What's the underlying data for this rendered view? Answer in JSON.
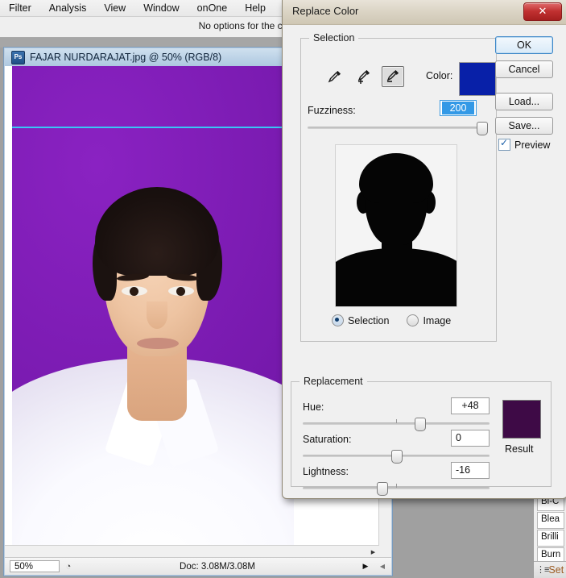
{
  "menubar": {
    "items": [
      "Filter",
      "Analysis",
      "View",
      "Window",
      "onOne",
      "Help"
    ]
  },
  "options_bar": {
    "text": "No options for the current tool."
  },
  "document_window": {
    "title": "FAJAR NURDARAJAT.jpg @ 50% (RGB/8)",
    "app_icon": "photoshop-icon",
    "status": {
      "zoom": "50%",
      "doc": "Doc: 3.08M/3.08M"
    }
  },
  "dialog": {
    "title": "Replace Color",
    "close_label": "✕",
    "selection": {
      "legend": "Selection",
      "eyedroppers": [
        {
          "name": "eyedropper-icon",
          "mode": "base",
          "selected": false
        },
        {
          "name": "eyedropper-add-icon",
          "mode": "add",
          "selected": false
        },
        {
          "name": "eyedropper-subtract-icon",
          "mode": "subtract",
          "selected": true
        }
      ],
      "color_label": "Color:",
      "color_value": "#0820A8",
      "fuzziness_label": "Fuzziness:",
      "fuzziness_value": "200",
      "fuzziness_percent": 100,
      "preview_modes": [
        {
          "label": "Selection",
          "selected": true
        },
        {
          "label": "Image",
          "selected": false
        }
      ]
    },
    "replacement": {
      "legend": "Replacement",
      "hue_label": "Hue:",
      "hue_value": "+48",
      "hue_percent": 63,
      "saturation_label": "Saturation:",
      "saturation_value": "0",
      "saturation_percent": 50,
      "lightness_label": "Lightness:",
      "lightness_value": "-16",
      "lightness_percent": 42,
      "result_label": "Result",
      "result_color": "#3E0A46"
    },
    "buttons": [
      {
        "label": "OK",
        "primary": true
      },
      {
        "label": "Cancel",
        "primary": false
      },
      {
        "label": "Load...",
        "primary": false
      },
      {
        "label": "Save...",
        "primary": false
      }
    ],
    "preview_checkbox": {
      "label": "Preview",
      "checked": true
    }
  },
  "right_panel": {
    "rows": [
      "Bi-C",
      "Blea",
      "Brilli",
      "Burn"
    ],
    "footer_icon": "list-icon",
    "footer_label": "Set"
  }
}
